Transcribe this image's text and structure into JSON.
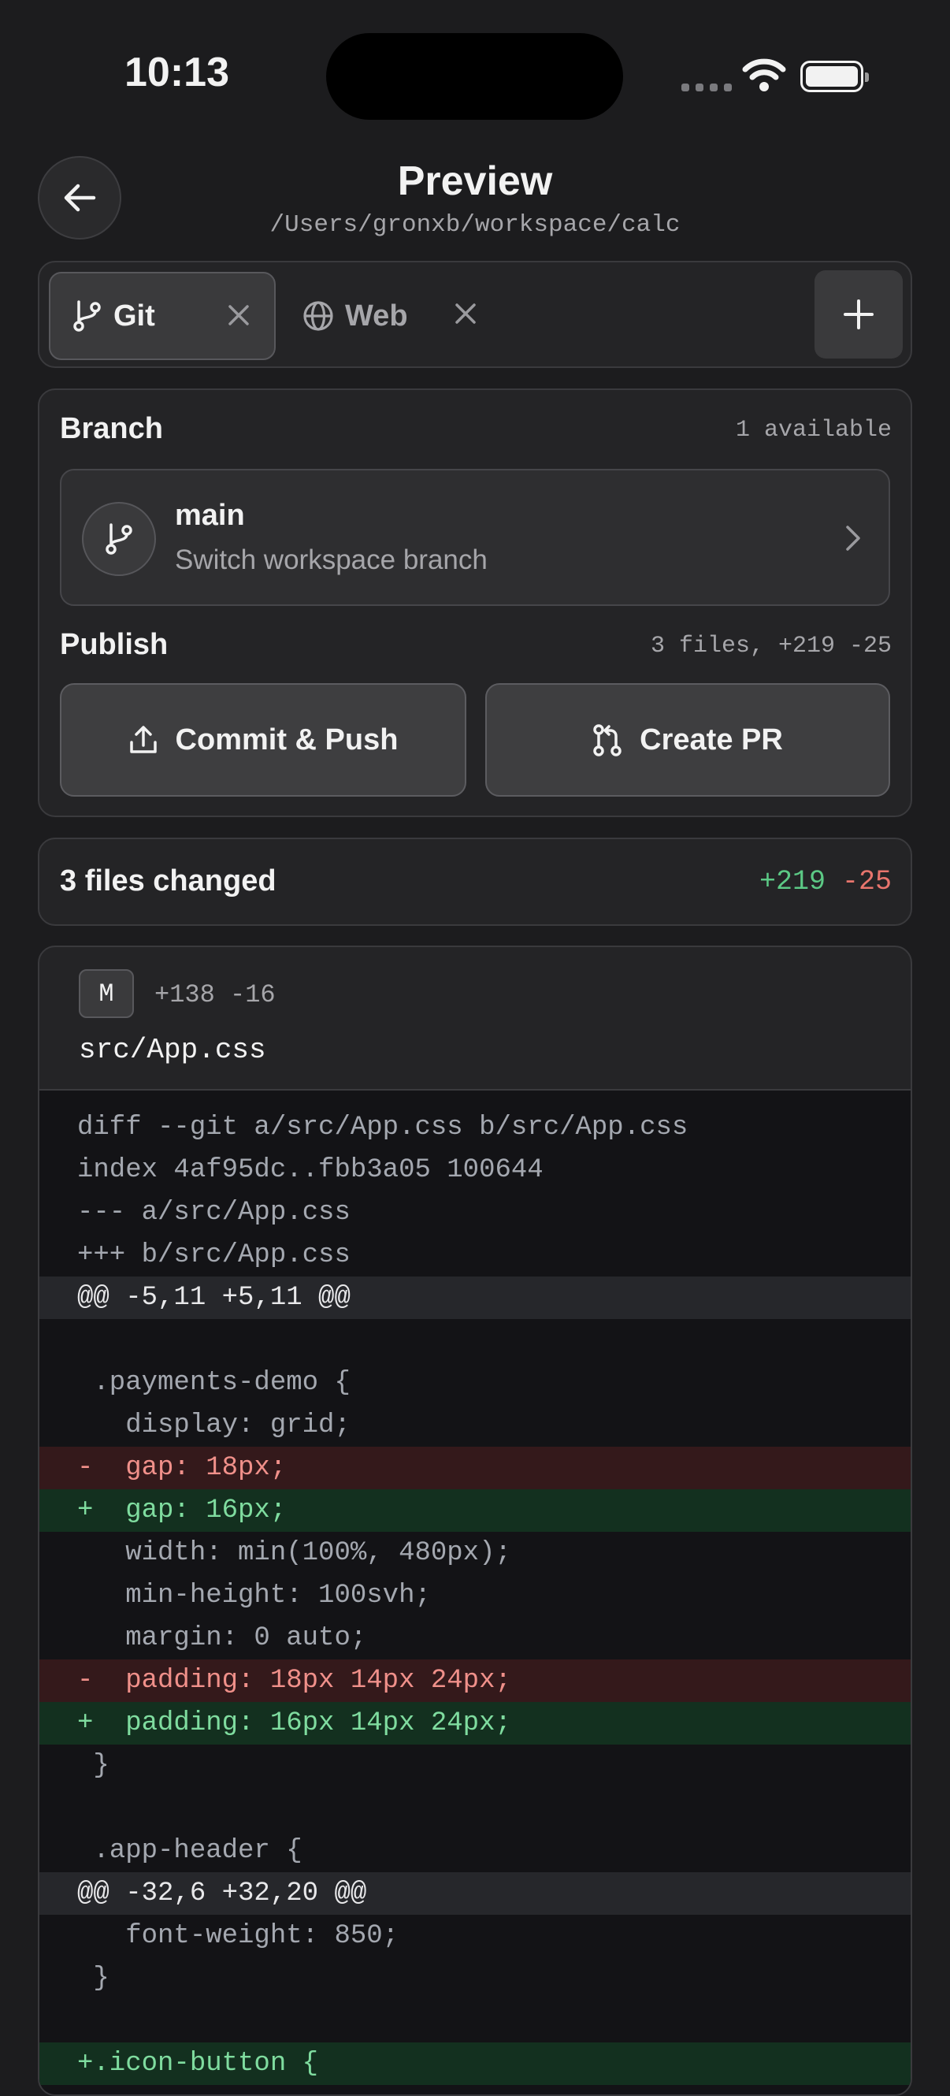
{
  "status": {
    "time": "10:13"
  },
  "header": {
    "title": "Preview",
    "path": "/Users/gronxb/workspace/calc"
  },
  "tabs": [
    {
      "label": "Git",
      "icon": "git-branch-icon",
      "active": true
    },
    {
      "label": "Web",
      "icon": "globe-icon",
      "active": false
    }
  ],
  "branch": {
    "title": "Branch",
    "available": "1 available",
    "name": "main",
    "subtitle": "Switch workspace branch"
  },
  "publish": {
    "title": "Publish",
    "summary": "3 files, +219 -25",
    "commit_label": "Commit & Push",
    "pr_label": "Create PR"
  },
  "changes": {
    "title": "3 files changed",
    "additions": "+219",
    "deletions": "-25"
  },
  "file": {
    "badge": "M",
    "stats": "+138 -16",
    "name": "src/App.css",
    "lines": [
      {
        "type": "meta",
        "text": "diff --git a/src/App.css b/src/App.css"
      },
      {
        "type": "meta",
        "text": "index 4af95dc..fbb3a05 100644"
      },
      {
        "type": "meta",
        "text": "--- a/src/App.css"
      },
      {
        "type": "meta",
        "text": "+++ b/src/App.css"
      },
      {
        "type": "hunk",
        "text": "@@ -5,11 +5,11 @@"
      },
      {
        "type": "ctx",
        "text": " "
      },
      {
        "type": "ctx",
        "text": " .payments-demo {"
      },
      {
        "type": "ctx",
        "text": "   display: grid;"
      },
      {
        "type": "del",
        "text": "-  gap: 18px;"
      },
      {
        "type": "add",
        "text": "+  gap: 16px;"
      },
      {
        "type": "ctx",
        "text": "   width: min(100%, 480px);"
      },
      {
        "type": "ctx",
        "text": "   min-height: 100svh;"
      },
      {
        "type": "ctx",
        "text": "   margin: 0 auto;"
      },
      {
        "type": "del",
        "text": "-  padding: 18px 14px 24px;"
      },
      {
        "type": "add",
        "text": "+  padding: 16px 14px 24px;"
      },
      {
        "type": "ctx",
        "text": " }"
      },
      {
        "type": "ctx",
        "text": " "
      },
      {
        "type": "ctx",
        "text": " .app-header {"
      },
      {
        "type": "hunk",
        "text": "@@ -32,6 +32,20 @@"
      },
      {
        "type": "ctx",
        "text": "   font-weight: 850;"
      },
      {
        "type": "ctx",
        "text": " }"
      },
      {
        "type": "ctx",
        "text": " "
      },
      {
        "type": "add",
        "text": "+.icon-button {"
      }
    ]
  }
}
